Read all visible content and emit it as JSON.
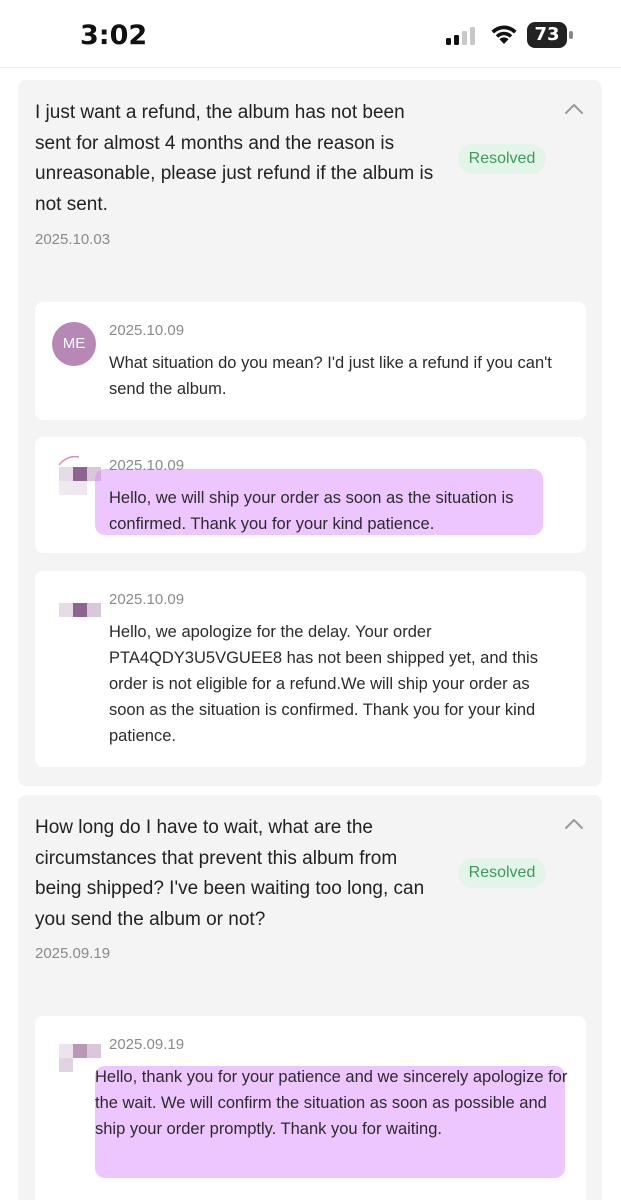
{
  "status_bar": {
    "time": "3:02",
    "battery": "73",
    "icons": [
      "signal-icon",
      "wifi-icon",
      "battery-icon"
    ]
  },
  "colors": {
    "badge_bg": "#e3f4e8",
    "badge_text": "#3c9a5b",
    "highlight": "#d678ff",
    "avatar": "#b788b5"
  },
  "inquiries": [
    {
      "question": "I just want a refund, the album has not been sent for almost 4 months and the reason is unreasonable, please just refund if the album is not sent.",
      "date": "2025.10.03",
      "status": "Resolved",
      "messages": [
        {
          "avatar_label": "ME",
          "date": "2025.10.09",
          "text": "What situation do you mean? I'd just like a refund if you can't send the album."
        },
        {
          "date": "2025.10.09",
          "text": "Hello, we will ship your order as soon as the situation is confirmed. Thank you for your kind patience."
        },
        {
          "date": "2025.10.09",
          "text": "Hello, we apologize for the delay. Your order PTA4QDY3U5VGUEE8 has not been shipped yet, and this order is not eligible for a refund.We will ship your order as soon as the situation is confirmed. Thank you for your kind patience."
        }
      ]
    },
    {
      "question": "How long do I have to wait, what are the circumstances that prevent this album from being shipped? I've been waiting too long, can you send the album or not?",
      "date": "2025.09.19",
      "status": "Resolved",
      "messages": [
        {
          "date": "2025.09.19",
          "text": "Hello, thank you for your patience and we sincerely apologize for the wait. We will confirm the situation as soon as possible and ship your order promptly. Thank you for waiting."
        }
      ]
    }
  ]
}
